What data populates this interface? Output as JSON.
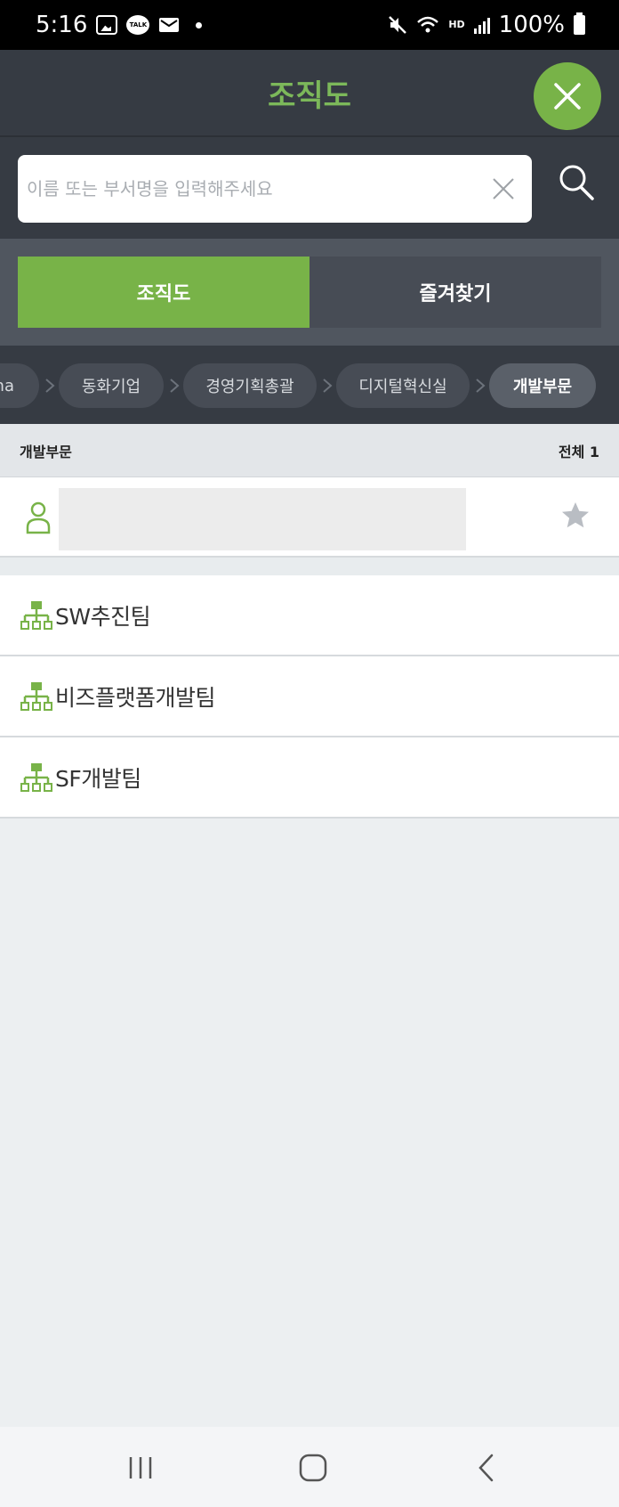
{
  "status_bar": {
    "time": "5:16",
    "battery": "100%",
    "hd_label": "HD",
    "talk_label": "TALK"
  },
  "header": {
    "title": "조직도"
  },
  "search": {
    "placeholder": "이름 또는 부서명을 입력해주세요"
  },
  "tabs": [
    {
      "label": "조직도",
      "active": true
    },
    {
      "label": "즐겨찾기",
      "active": false
    }
  ],
  "breadcrumb": [
    {
      "label": "ha"
    },
    {
      "label": "동화기업"
    },
    {
      "label": "경영기획총괄"
    },
    {
      "label": "디지털혁신실"
    },
    {
      "label": "개발부문",
      "current": true
    }
  ],
  "section": {
    "title": "개발부문",
    "count_label": "전체 1"
  },
  "departments": [
    {
      "label": "SW추진팀"
    },
    {
      "label": "비즈플랫폼개발팀"
    },
    {
      "label": "SF개발팀"
    }
  ],
  "colors": {
    "accent": "#78b348",
    "header_bg": "#363b43",
    "title_green": "#7cb85a"
  }
}
